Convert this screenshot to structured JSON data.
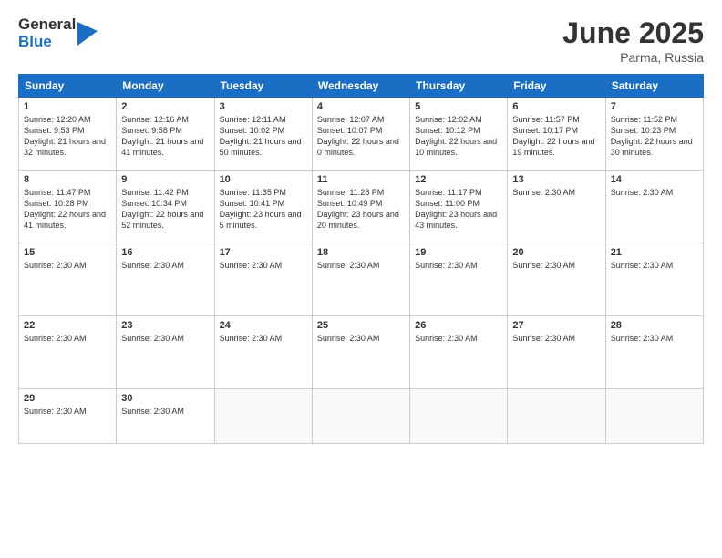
{
  "logo": {
    "general": "General",
    "blue": "Blue"
  },
  "title": {
    "month": "June 2025",
    "location": "Parma, Russia"
  },
  "weekdays": [
    "Sunday",
    "Monday",
    "Tuesday",
    "Wednesday",
    "Thursday",
    "Friday",
    "Saturday"
  ],
  "weeks": [
    [
      {
        "day": "1",
        "info": "Sunrise: 12:20 AM\nSunset: 9:53 PM\nDaylight: 21 hours and 32 minutes."
      },
      {
        "day": "2",
        "info": "Sunrise: 12:16 AM\nSunset: 9:58 PM\nDaylight: 21 hours and 41 minutes."
      },
      {
        "day": "3",
        "info": "Sunrise: 12:11 AM\nSunset: 10:02 PM\nDaylight: 21 hours and 50 minutes."
      },
      {
        "day": "4",
        "info": "Sunrise: 12:07 AM\nSunset: 10:07 PM\nDaylight: 22 hours and 0 minutes."
      },
      {
        "day": "5",
        "info": "Sunrise: 12:02 AM\nSunset: 10:12 PM\nDaylight: 22 hours and 10 minutes."
      },
      {
        "day": "6",
        "info": "Sunrise: 11:57 PM\nSunset: 10:17 PM\nDaylight: 22 hours and 19 minutes."
      },
      {
        "day": "7",
        "info": "Sunrise: 11:52 PM\nSunset: 10:23 PM\nDaylight: 22 hours and 30 minutes."
      }
    ],
    [
      {
        "day": "8",
        "info": "Sunrise: 11:47 PM\nSunset: 10:28 PM\nDaylight: 22 hours and 41 minutes."
      },
      {
        "day": "9",
        "info": "Sunrise: 11:42 PM\nSunset: 10:34 PM\nDaylight: 22 hours and 52 minutes."
      },
      {
        "day": "10",
        "info": "Sunrise: 11:35 PM\nSunset: 10:41 PM\nDaylight: 23 hours and 5 minutes."
      },
      {
        "day": "11",
        "info": "Sunrise: 11:28 PM\nSunset: 10:49 PM\nDaylight: 23 hours and 20 minutes."
      },
      {
        "day": "12",
        "info": "Sunrise: 11:17 PM\nSunset: 11:00 PM\nDaylight: 23 hours and 43 minutes."
      },
      {
        "day": "13",
        "info": "Sunrise: 2:30 AM"
      },
      {
        "day": "14",
        "info": "Sunrise: 2:30 AM"
      }
    ],
    [
      {
        "day": "15",
        "info": "Sunrise: 2:30 AM"
      },
      {
        "day": "16",
        "info": "Sunrise: 2:30 AM"
      },
      {
        "day": "17",
        "info": "Sunrise: 2:30 AM"
      },
      {
        "day": "18",
        "info": "Sunrise: 2:30 AM"
      },
      {
        "day": "19",
        "info": "Sunrise: 2:30 AM"
      },
      {
        "day": "20",
        "info": "Sunrise: 2:30 AM"
      },
      {
        "day": "21",
        "info": "Sunrise: 2:30 AM"
      }
    ],
    [
      {
        "day": "22",
        "info": "Sunrise: 2:30 AM"
      },
      {
        "day": "23",
        "info": "Sunrise: 2:30 AM"
      },
      {
        "day": "24",
        "info": "Sunrise: 2:30 AM"
      },
      {
        "day": "25",
        "info": "Sunrise: 2:30 AM"
      },
      {
        "day": "26",
        "info": "Sunrise: 2:30 AM"
      },
      {
        "day": "27",
        "info": "Sunrise: 2:30 AM"
      },
      {
        "day": "28",
        "info": "Sunrise: 2:30 AM"
      }
    ],
    [
      {
        "day": "29",
        "info": "Sunrise: 2:30 AM"
      },
      {
        "day": "30",
        "info": "Sunrise: 2:30 AM"
      },
      {
        "day": "",
        "info": ""
      },
      {
        "day": "",
        "info": ""
      },
      {
        "day": "",
        "info": ""
      },
      {
        "day": "",
        "info": ""
      },
      {
        "day": "",
        "info": ""
      }
    ]
  ]
}
